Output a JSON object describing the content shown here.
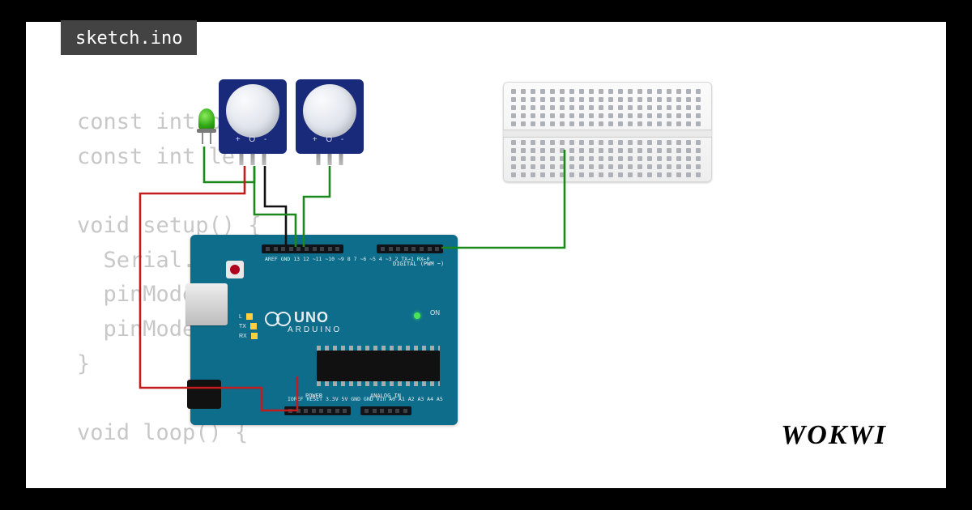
{
  "tab": {
    "title": "sketch.ino"
  },
  "code": {
    "text": "const int pi\nconst int le\n\nvoid setup() {\n  Serial.begin(9600);\n  pinMode(             T);\n  pinMode(             T);\n}\n\nvoid loop() {"
  },
  "brand": {
    "name": "WOKWI"
  },
  "arduino": {
    "logo": "UNO",
    "sub": "ARDUINO",
    "digital_label": "DIGITAL (PWM ~)",
    "analog_label": "ANALOG IN",
    "power_label": "POWER",
    "on": "ON",
    "leds": "L\nTX\nRX",
    "pins_top": "AREF GND 13 12 ~11 ~10 ~9 8   7 ~6 ~5 4 ~3 2 TX→1 RX←0",
    "pins_bot": "IOREF RESET 3.3V 5V GND GND Vin   A0 A1 A2 A3 A4 A5"
  },
  "pir": {
    "labels": "+ O -"
  }
}
